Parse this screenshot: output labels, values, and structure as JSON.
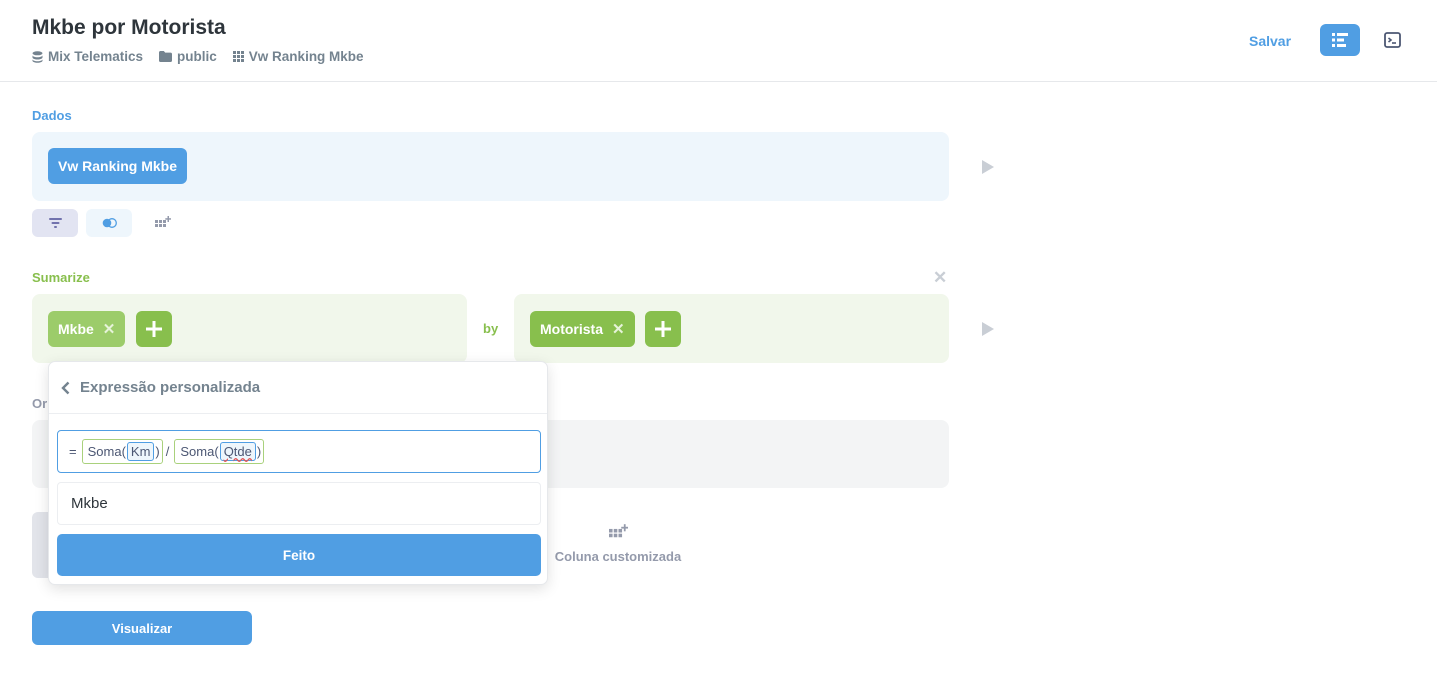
{
  "header": {
    "title": "Mkbe por Motorista",
    "breadcrumbs": [
      {
        "label": "Mix Telematics",
        "icon": "database-icon"
      },
      {
        "label": "public",
        "icon": "folder-icon"
      },
      {
        "label": "Vw Ranking Mkbe",
        "icon": "table-grid-icon"
      }
    ],
    "save_label": "Salvar",
    "accent": "#509ee3"
  },
  "data_step": {
    "label": "Dados",
    "table": "Vw Ranking Mkbe",
    "actions": [
      "filter-icon",
      "join-icon",
      "custom-column-icon"
    ]
  },
  "summarize_step": {
    "label": "Sumarize",
    "metric": "Mkbe",
    "by_label": "by",
    "breakout": "Motorista",
    "color": "#88bf4d"
  },
  "sort_step": {
    "label": "Or"
  },
  "custom_column": {
    "label": "Coluna customizada"
  },
  "visualize_label": "Visualizar",
  "popover": {
    "title": "Expressão personalizada",
    "expression": {
      "equals": "=",
      "left_fn": "Soma",
      "left_field": "Km",
      "operator": "/",
      "right_fn": "Soma",
      "right_field": "Qtde"
    },
    "name_value": "Mkbe",
    "done_label": "Feito"
  }
}
